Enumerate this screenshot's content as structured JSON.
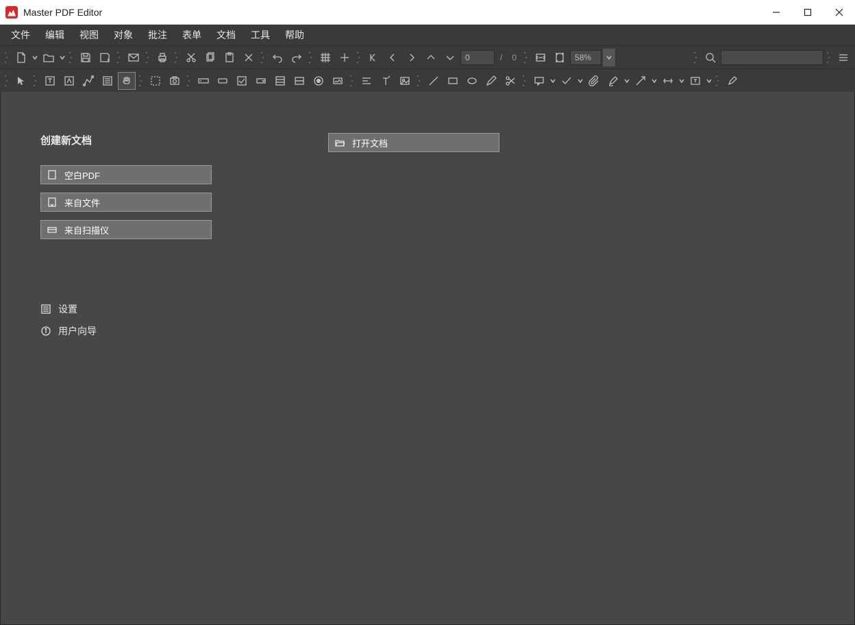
{
  "titlebar": {
    "title": "Master PDF Editor"
  },
  "menu": {
    "file": "文件",
    "edit": "编辑",
    "view": "视图",
    "object": "对象",
    "comment": "批注",
    "forms": "表单",
    "document": "文档",
    "tools": "工具",
    "help": "帮助"
  },
  "toolbar": {
    "page_current": "0",
    "page_sep": "/",
    "page_total": "0",
    "zoom": "58%",
    "search": ""
  },
  "start": {
    "create_title": "创建新文档",
    "blank": "空白PDF",
    "from_file": "来自文件",
    "from_scanner": "来自扫描仪",
    "open_doc": "打开文档",
    "settings": "设置",
    "guide": "用户向导"
  }
}
